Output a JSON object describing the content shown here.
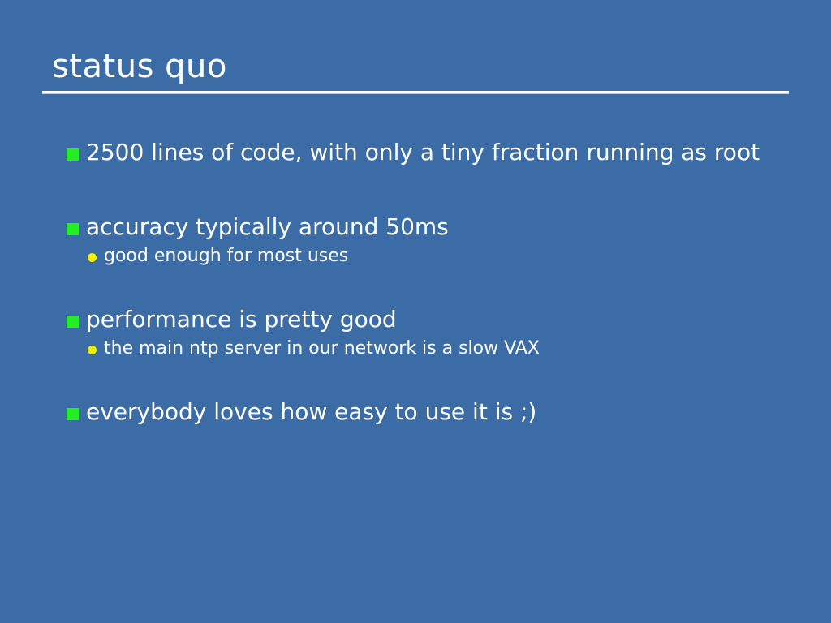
{
  "slide": {
    "title": "status quo",
    "bullets": [
      {
        "text": "2500 lines of code, with only a tiny fraction running as root"
      },
      {
        "text": "accuracy typically around 50ms",
        "sub": [
          "good enough for most uses"
        ]
      },
      {
        "text": "performance is pretty good",
        "sub": [
          "the main ntp server in our network is a slow VAX"
        ]
      },
      {
        "text": "everybody loves how easy to use it is ;)"
      }
    ]
  },
  "colors": {
    "background": "#3c6ca6",
    "bullet_square": "#22ee22",
    "sub_bullet_dot": "#f0f000",
    "text": "#ffffff"
  },
  "icons": {
    "bullet": "green-square-bullet-icon",
    "sub_bullet": "yellow-dot-bullet-icon"
  }
}
